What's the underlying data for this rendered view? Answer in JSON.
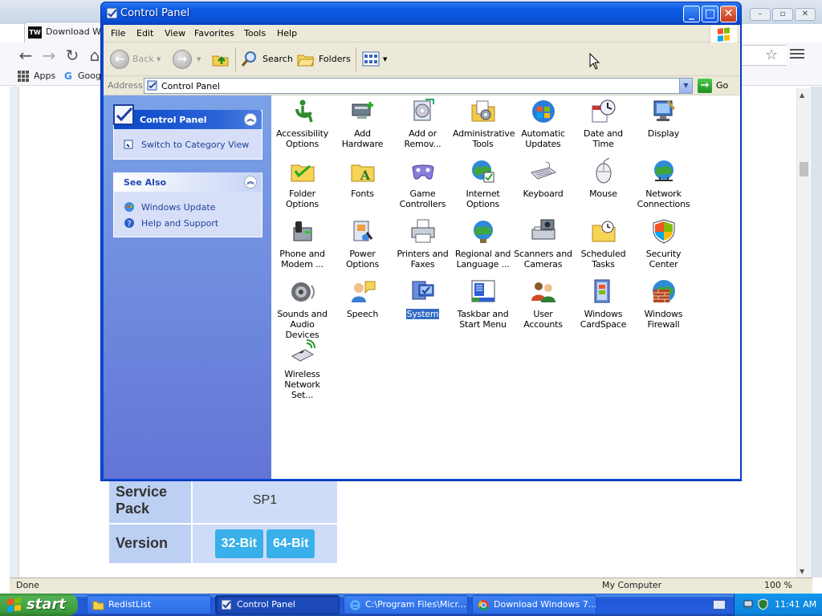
{
  "chrome": {
    "tab_title": "Download Wind",
    "tw_logo": "TW",
    "bookmarks": {
      "apps": "Apps",
      "google": "Goog"
    },
    "status": {
      "left": "Done",
      "zone": "My Computer",
      "zoom": "100 %"
    }
  },
  "page_table": {
    "service_pack_label_1": "Service",
    "service_pack_label_2": "Pack",
    "service_pack_value": "SP1",
    "version_label": "Version",
    "btn_32": "32-Bit",
    "btn_64": "64-Bit"
  },
  "control_panel": {
    "title": "Control Panel",
    "menu": [
      "File",
      "Edit",
      "View",
      "Favorites",
      "Tools",
      "Help"
    ],
    "toolbar": {
      "back": "Back",
      "search": "Search",
      "folders": "Folders"
    },
    "address": {
      "label": "Address",
      "value": "Control Panel",
      "go": "Go"
    },
    "taskpane": {
      "panel_title": "Control Panel",
      "switch_link": "Switch to Category View",
      "see_also_title": "See Also",
      "see_also": [
        "Windows Update",
        "Help and Support"
      ]
    },
    "items": [
      {
        "l1": "Accessibility",
        "l2": "Options",
        "icon": "accessibility-icon"
      },
      {
        "l1": "Add Hardware",
        "l2": "",
        "icon": "add-hardware-icon"
      },
      {
        "l1": "Add or",
        "l2": "Remov...",
        "icon": "add-remove-programs-icon"
      },
      {
        "l1": "Administrative",
        "l2": "Tools",
        "icon": "administrative-tools-icon"
      },
      {
        "l1": "Automatic",
        "l2": "Updates",
        "icon": "automatic-updates-icon"
      },
      {
        "l1": "Date and Time",
        "l2": "",
        "icon": "date-time-icon"
      },
      {
        "l1": "Display",
        "l2": "",
        "icon": "display-icon"
      },
      {
        "l1": "Folder Options",
        "l2": "",
        "icon": "folder-options-icon"
      },
      {
        "l1": "Fonts",
        "l2": "",
        "icon": "fonts-icon"
      },
      {
        "l1": "Game",
        "l2": "Controllers",
        "icon": "game-controllers-icon"
      },
      {
        "l1": "Internet",
        "l2": "Options",
        "icon": "internet-options-icon"
      },
      {
        "l1": "Keyboard",
        "l2": "",
        "icon": "keyboard-icon"
      },
      {
        "l1": "Mouse",
        "l2": "",
        "icon": "mouse-icon"
      },
      {
        "l1": "Network",
        "l2": "Connections",
        "icon": "network-connections-icon"
      },
      {
        "l1": "Phone and",
        "l2": "Modem ...",
        "icon": "phone-modem-icon"
      },
      {
        "l1": "Power Options",
        "l2": "",
        "icon": "power-options-icon"
      },
      {
        "l1": "Printers and",
        "l2": "Faxes",
        "icon": "printers-faxes-icon"
      },
      {
        "l1": "Regional and",
        "l2": "Language ...",
        "icon": "regional-language-icon"
      },
      {
        "l1": "Scanners and",
        "l2": "Cameras",
        "icon": "scanners-cameras-icon"
      },
      {
        "l1": "Scheduled",
        "l2": "Tasks",
        "icon": "scheduled-tasks-icon"
      },
      {
        "l1": "Security",
        "l2": "Center",
        "icon": "security-center-icon"
      },
      {
        "l1": "Sounds and",
        "l2": "Audio Devices",
        "icon": "sounds-audio-icon"
      },
      {
        "l1": "Speech",
        "l2": "",
        "icon": "speech-icon"
      },
      {
        "l1": "System",
        "l2": "",
        "icon": "system-icon",
        "selected": true
      },
      {
        "l1": "Taskbar and",
        "l2": "Start Menu",
        "icon": "taskbar-start-menu-icon"
      },
      {
        "l1": "User Accounts",
        "l2": "",
        "icon": "user-accounts-icon"
      },
      {
        "l1": "Windows",
        "l2": "CardSpace",
        "icon": "windows-cardspace-icon"
      },
      {
        "l1": "Windows",
        "l2": "Firewall",
        "icon": "windows-firewall-icon"
      },
      {
        "l1": "Wireless",
        "l2": "Network Set...",
        "icon": "wireless-network-icon"
      }
    ]
  },
  "taskbar": {
    "start": "start",
    "tasks": [
      "RedistList",
      "Control Panel",
      "C:\\Program Files\\Micr...",
      "Download Windows 7..."
    ],
    "clock": "11:41 AM"
  },
  "colors": {
    "xp_blue": "#0a48d8",
    "taskpane": "#6f8ee0",
    "selection": "#316ac5",
    "start_green": "#3b9b3b"
  }
}
